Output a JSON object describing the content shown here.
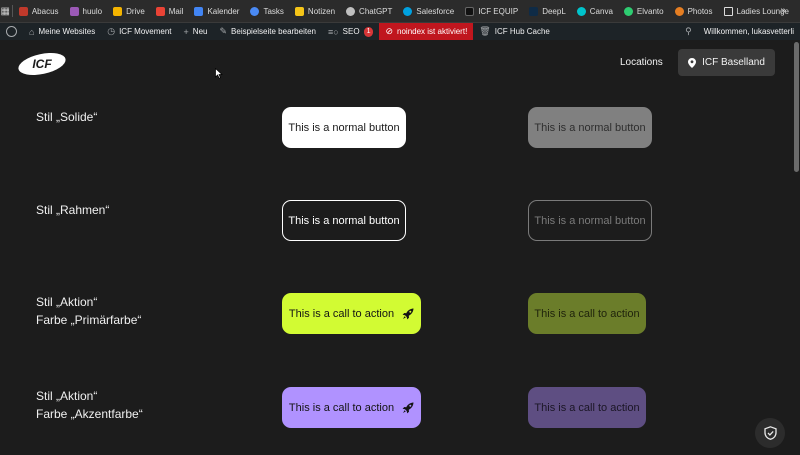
{
  "bookmarks": {
    "items": [
      {
        "label": "Abacus",
        "icon": "abacus-icon",
        "color": "#c0392b"
      },
      {
        "label": "huulo",
        "icon": "huulo-icon",
        "color": "#9b59b6"
      },
      {
        "label": "Drive",
        "icon": "drive-icon",
        "color": "#f4b400"
      },
      {
        "label": "Mail",
        "icon": "gmail-icon",
        "color": "#ea4335"
      },
      {
        "label": "Kalender",
        "icon": "calendar-icon",
        "color": "#4285f4"
      },
      {
        "label": "Tasks",
        "icon": "tasks-icon",
        "color": "#4a8af4"
      },
      {
        "label": "Notizen",
        "icon": "notes-icon",
        "color": "#f5c518"
      },
      {
        "label": "ChatGPT",
        "icon": "chatgpt-icon",
        "color": "#bfbfbf"
      },
      {
        "label": "Salesforce",
        "icon": "salesforce-icon",
        "color": "#00a1e0"
      },
      {
        "label": "ICF EQUIP",
        "icon": "icf-equip-icon",
        "color": "#111111"
      },
      {
        "label": "DeepL",
        "icon": "deepl-icon",
        "color": "#0f2b46"
      },
      {
        "label": "Canva",
        "icon": "canva-icon",
        "color": "#00c4cc"
      },
      {
        "label": "Elvanto",
        "icon": "elvanto-icon",
        "color": "#2ecc71"
      },
      {
        "label": "Photos",
        "icon": "photos-icon",
        "color": "#e67e22"
      },
      {
        "label": "Ladies Lounge",
        "icon": "folder-icon",
        "color": "#dcdcdc"
      }
    ],
    "more": "»"
  },
  "adminbar": {
    "my_sites": "Meine Websites",
    "site_name": "ICF Movement",
    "new": "Neu",
    "edit": "Beispielseite bearbeiten",
    "seo": "SEO",
    "seo_count": "1",
    "noindex": "noindex ist aktiviert!",
    "cache": "ICF Hub Cache",
    "greeting": "Willkommen, lukasvetterli"
  },
  "header": {
    "logo_text": "ICF",
    "locations": "Locations",
    "location_button": "ICF Baselland"
  },
  "rows": [
    {
      "label_line1": "Stil „Solide“",
      "label_line2": "",
      "btn_text": "This is a normal button",
      "btn_disabled_text": "This is a normal button"
    },
    {
      "label_line1": "Stil „Rahmen“",
      "label_line2": "",
      "btn_text": "This is a normal button",
      "btn_disabled_text": "This is a normal button"
    },
    {
      "label_line1": "Stil „Aktion“",
      "label_line2": "Farbe „Primärfarbe“",
      "btn_text": "This is a call to action",
      "btn_disabled_text": "This is a call to action"
    },
    {
      "label_line1": "Stil „Aktion“",
      "label_line2": "Farbe „Akzentfarbe“",
      "btn_text": "This is a call to action",
      "btn_disabled_text": "This is a call to action"
    }
  ],
  "colors": {
    "background": "#1c1c1c",
    "primary": "#d2fb33",
    "accent": "#b092ff",
    "noindex": "#c0161e"
  }
}
